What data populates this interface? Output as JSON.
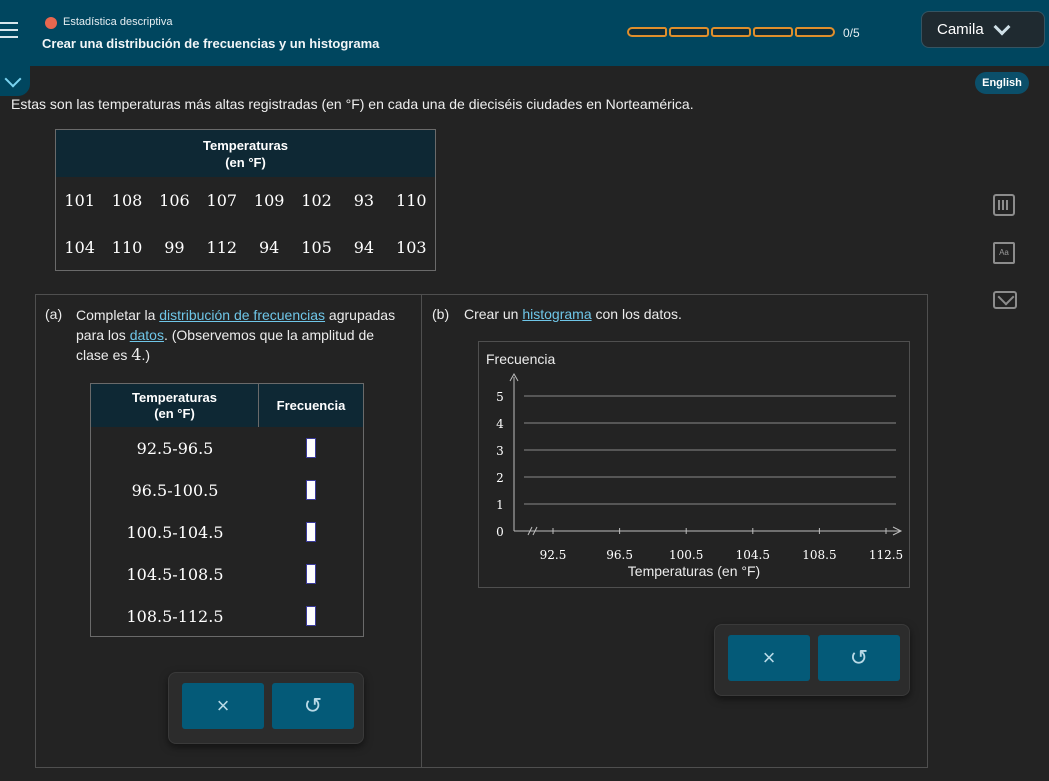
{
  "header": {
    "course": "Estadística descriptiva",
    "lesson": "Crear una distribución de frecuencias y un histograma",
    "progress_text": "0/5",
    "progress_segments": 5,
    "progress_filled": 0,
    "user": "Camila"
  },
  "language_button": "English",
  "intro": "Estas son las temperaturas más altas registradas (en °F) en cada una de dieciséis ciudades en Norteamérica.",
  "data_table": {
    "header_line1": "Temperaturas",
    "header_line2": "(en °F)",
    "rows": [
      [
        "101",
        "108",
        "106",
        "107",
        "109",
        "102",
        "93",
        "110"
      ],
      [
        "104",
        "110",
        "99",
        "112",
        "94",
        "105",
        "94",
        "103"
      ]
    ]
  },
  "part_a": {
    "label": "(a)",
    "text_1": "Completar la ",
    "link_1": "distribución de frecuencias",
    "text_2": " agrupadas para los ",
    "link_2": "datos",
    "text_3": ". (Observemos que la amplitud de clase es ",
    "class_width": "4",
    "text_4": ".)",
    "table": {
      "col1_line1": "Temperaturas",
      "col1_line2": "(en °F)",
      "col2": "Frecuencia",
      "rows": [
        "92.5-96.5",
        "96.5-100.5",
        "100.5-104.5",
        "104.5-108.5",
        "108.5-112.5"
      ]
    },
    "buttons": {
      "clear": "×",
      "undo": "↺"
    }
  },
  "part_b": {
    "label": "(b)",
    "text_1": "Crear un ",
    "link": "histograma",
    "text_2": " con los datos.",
    "buttons": {
      "clear": "×",
      "undo": "↺"
    }
  },
  "chart_data": {
    "type": "bar",
    "title": "",
    "ylabel": "Frecuencia",
    "xlabel": "Temperaturas (en °F)",
    "y_ticks": [
      0,
      1,
      2,
      3,
      4,
      5
    ],
    "ylim": [
      0,
      5
    ],
    "x_ticks": [
      "92.5",
      "96.5",
      "100.5",
      "104.5",
      "108.5",
      "112.5"
    ],
    "xlim": [
      92.5,
      112.5
    ],
    "categories": [
      "92.5-96.5",
      "96.5-100.5",
      "100.5-104.5",
      "104.5-108.5",
      "108.5-112.5"
    ],
    "values": [],
    "grid": true
  },
  "colors": {
    "header_bg": "#00465f",
    "progress_border": "#e08f2c",
    "link": "#6fc6e8",
    "button": "#045a78"
  }
}
